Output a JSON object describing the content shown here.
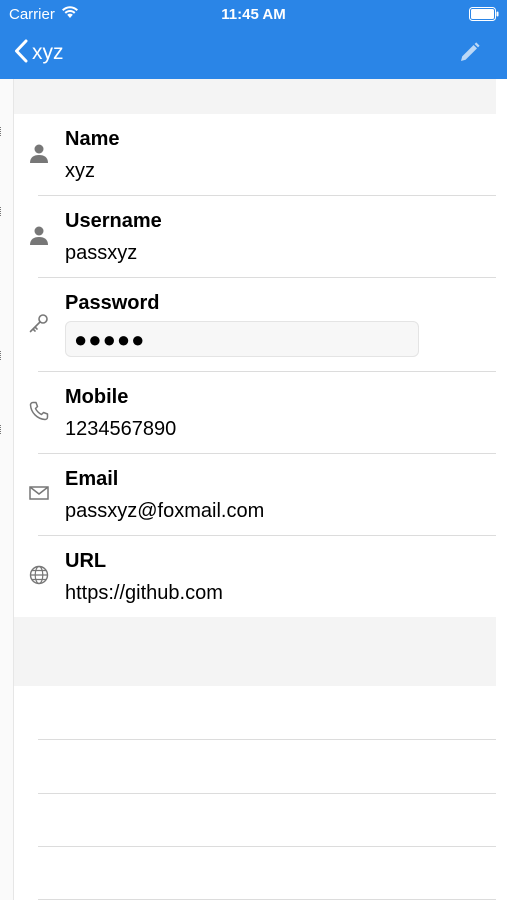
{
  "status_bar": {
    "carrier": "Carrier",
    "time": "11:45 AM"
  },
  "nav": {
    "back_title": "xyz"
  },
  "fields": [
    {
      "label": "Name",
      "value": "xyz",
      "icon": "person-icon"
    },
    {
      "label": "Username",
      "value": "passxyz",
      "icon": "person-icon"
    },
    {
      "label": "Password",
      "value": "●●●●●",
      "icon": "key-icon"
    },
    {
      "label": "Mobile",
      "value": "1234567890",
      "icon": "phone-icon"
    },
    {
      "label": "Email",
      "value": "passxyz@foxmail.com",
      "icon": "mail-icon"
    },
    {
      "label": "URL",
      "value": "https://github.com",
      "icon": "globe-icon"
    }
  ],
  "colors": {
    "accent": "#2a85e7",
    "section_gray": "#f4f4f4",
    "icon_gray": "#777777"
  }
}
